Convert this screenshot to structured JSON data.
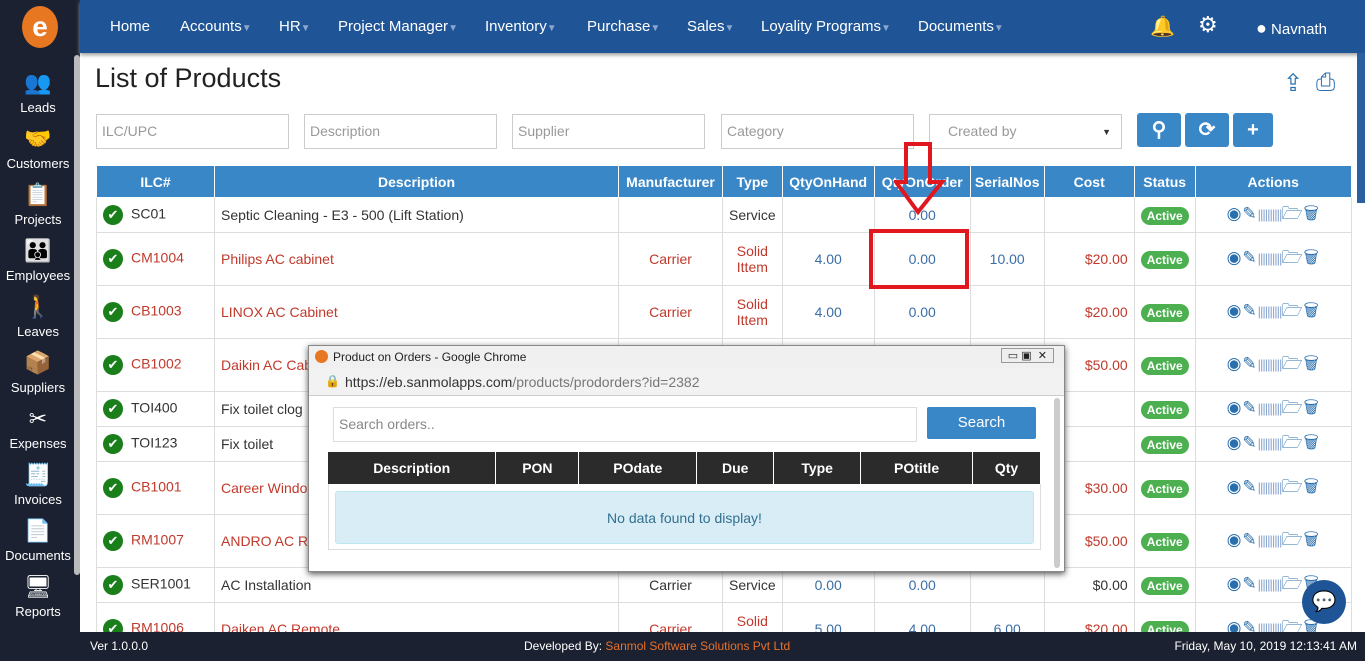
{
  "app": {
    "logo_letter": "e"
  },
  "sidebar": {
    "items": [
      {
        "label": "Leads",
        "icon": "leads-icon",
        "glyph": "👥"
      },
      {
        "label": "Customers",
        "icon": "customers-icon",
        "glyph": "🤝"
      },
      {
        "label": "Projects",
        "icon": "projects-icon",
        "glyph": "📋"
      },
      {
        "label": "Employees",
        "icon": "employees-icon",
        "glyph": "👪"
      },
      {
        "label": "Leaves",
        "icon": "leaves-icon",
        "glyph": "🚶"
      },
      {
        "label": "Suppliers",
        "icon": "suppliers-icon",
        "glyph": "📦"
      },
      {
        "label": "Expenses",
        "icon": "expenses-icon",
        "glyph": "✂"
      },
      {
        "label": "Invoices",
        "icon": "invoices-icon",
        "glyph": "🧾"
      },
      {
        "label": "Documents",
        "icon": "documents-icon",
        "glyph": "📄"
      },
      {
        "label": "Reports",
        "icon": "reports-icon",
        "glyph": "🖥"
      }
    ]
  },
  "nav": {
    "items": [
      {
        "label": "Home",
        "dropdown": false
      },
      {
        "label": "Accounts",
        "dropdown": true
      },
      {
        "label": "HR",
        "dropdown": true
      },
      {
        "label": "Project Manager",
        "dropdown": true
      },
      {
        "label": "Inventory",
        "dropdown": true
      },
      {
        "label": "Purchase",
        "dropdown": true
      },
      {
        "label": "Sales",
        "dropdown": true
      },
      {
        "label": "Loyality Programs",
        "dropdown": true
      },
      {
        "label": "Documents",
        "dropdown": true
      }
    ],
    "user": "Navnath"
  },
  "page": {
    "title": "List of Products"
  },
  "filters": {
    "ilc": "ILC/UPC",
    "description": "Description",
    "supplier": "Supplier",
    "category": "Category",
    "created_by": "Created by"
  },
  "table": {
    "headers": [
      "ILC#",
      "Description",
      "Manufacturer",
      "Type",
      "QtyOnHand",
      "QtyOnOrder",
      "SerialNos",
      "Cost",
      "Status",
      "Actions"
    ],
    "rows": [
      {
        "ilc": "SC01",
        "desc": "Septic Cleaning - E3 - 500 (Lift Station)",
        "mfr": "",
        "type": "Service",
        "qoh": "",
        "qoo": "0.00",
        "serial": "",
        "cost": "",
        "status": "Active",
        "style": "black"
      },
      {
        "ilc": "CM1004",
        "desc": "Philips AC cabinet",
        "mfr": "Carrier",
        "type": "Solid Ittem",
        "qoh": "4.00",
        "qoo": "0.00",
        "serial": "10.00",
        "cost": "$20.00",
        "status": "Active",
        "style": "red"
      },
      {
        "ilc": "CB1003",
        "desc": "LINOX AC Cabinet",
        "mfr": "Carrier",
        "type": "Solid Ittem",
        "qoh": "4.00",
        "qoo": "0.00",
        "serial": "",
        "cost": "$20.00",
        "status": "Active",
        "style": "red"
      },
      {
        "ilc": "CB1002",
        "desc": "Daikin AC Cab",
        "mfr": "",
        "type": "",
        "qoh": "",
        "qoo": "",
        "serial": "",
        "cost": "$50.00",
        "status": "Active",
        "style": "red",
        "tall": true
      },
      {
        "ilc": "TOI400",
        "desc": "Fix toilet clog",
        "mfr": "",
        "type": "",
        "qoh": "",
        "qoo": "",
        "serial": "",
        "cost": "",
        "status": "Active",
        "style": "black"
      },
      {
        "ilc": "TOI123",
        "desc": "Fix toilet",
        "mfr": "",
        "type": "",
        "qoh": "",
        "qoo": "",
        "serial": "",
        "cost": "",
        "status": "Active",
        "style": "black"
      },
      {
        "ilc": "CB1001",
        "desc": "Career Windo",
        "mfr": "",
        "type": "",
        "qoh": "",
        "qoo": "",
        "serial": "",
        "cost": "$30.00",
        "status": "Active",
        "style": "red",
        "tall": true
      },
      {
        "ilc": "RM1007",
        "desc": "ANDRO AC RE",
        "mfr": "",
        "type": "",
        "qoh": "",
        "qoo": "",
        "serial": "",
        "cost": "$50.00",
        "status": "Active",
        "style": "red",
        "tall": true
      },
      {
        "ilc": "SER1001",
        "desc": "AC Installation",
        "mfr": "Carrier",
        "type": "Service",
        "qoh": "0.00",
        "qoo": "0.00",
        "serial": "",
        "cost": "$0.00",
        "status": "Active",
        "style": "black"
      },
      {
        "ilc": "RM1006",
        "desc": "Daiken AC Remote",
        "mfr": "Carrier",
        "type": "Solid Ittem",
        "qoh": "5.00",
        "qoo": "4.00",
        "serial": "6.00",
        "cost": "$20.00",
        "status": "Active",
        "style": "red"
      }
    ]
  },
  "popup": {
    "window_title": "Product on Orders - Google Chrome",
    "url_host": "https://eb.sanmolapps.com",
    "url_path": "/products/prodorders?id=2382",
    "search_placeholder": "Search orders..",
    "search_button": "Search",
    "headers": [
      "Description",
      "PON",
      "POdate",
      "Due",
      "Type",
      "POtitle",
      "Qty"
    ],
    "empty_message": "No data found to display!"
  },
  "footer": {
    "version": "Ver 1.0.0.0",
    "dev_label": "Developed By:",
    "dev_name": "Sanmol Software Solutions Pvt Ltd",
    "datetime": "Friday, May 10, 2019 12:13:41 AM"
  },
  "colors": {
    "nav": "#1f5597",
    "sidebar": "#1b2130",
    "accent": "#3a87c8",
    "highlight": "#e0171f",
    "active": "#4caf50"
  }
}
